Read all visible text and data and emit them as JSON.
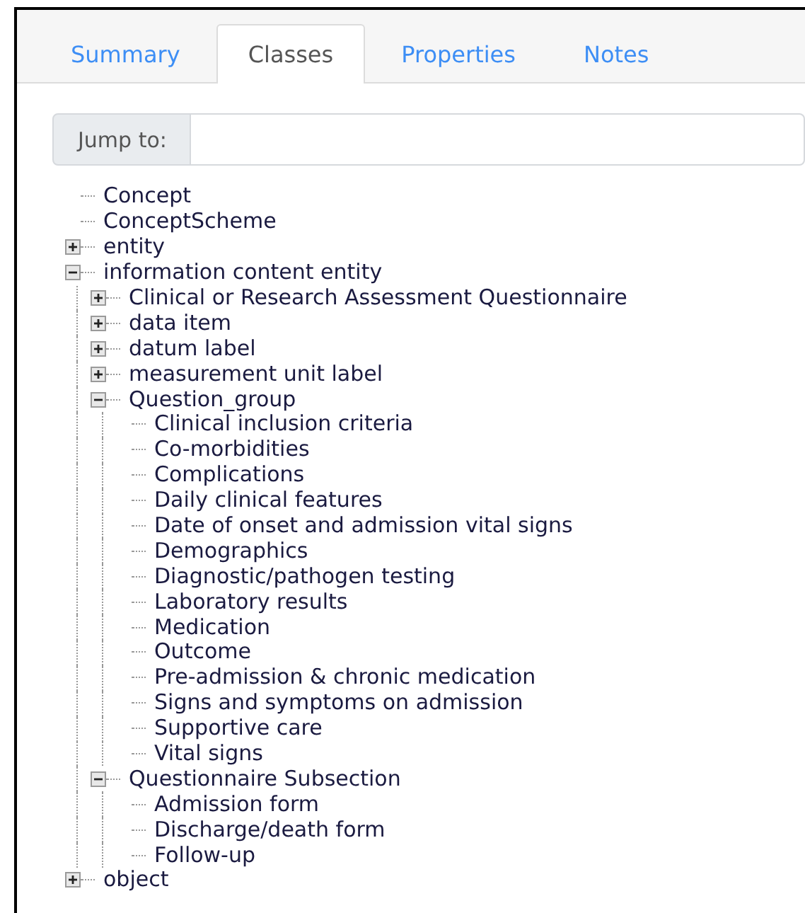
{
  "tabs": [
    {
      "label": "Summary",
      "selected": false
    },
    {
      "label": "Classes",
      "selected": true
    },
    {
      "label": "Properties",
      "selected": false
    },
    {
      "label": "Notes",
      "selected": false
    }
  ],
  "jump": {
    "label": "Jump to:"
  },
  "tree": [
    {
      "label": "Concept",
      "kind": "leaf"
    },
    {
      "label": "ConceptScheme",
      "kind": "leaf"
    },
    {
      "label": "entity",
      "kind": "branch",
      "expanded": false
    },
    {
      "label": "information content entity",
      "kind": "branch",
      "expanded": true,
      "children": [
        {
          "label": "Clinical or Research Assessment Questionnaire",
          "kind": "branch",
          "expanded": false
        },
        {
          "label": "data item",
          "kind": "branch",
          "expanded": false
        },
        {
          "label": "datum label",
          "kind": "branch",
          "expanded": false
        },
        {
          "label": "measurement unit label",
          "kind": "branch",
          "expanded": false
        },
        {
          "label": "Question_group",
          "kind": "branch",
          "expanded": true,
          "children": [
            {
              "label": "Clinical inclusion criteria",
              "kind": "leaf"
            },
            {
              "label": "Co-morbidities",
              "kind": "leaf"
            },
            {
              "label": "Complications",
              "kind": "leaf"
            },
            {
              "label": "Daily clinical features",
              "kind": "leaf"
            },
            {
              "label": "Date of onset and admission vital signs",
              "kind": "leaf"
            },
            {
              "label": "Demographics",
              "kind": "leaf"
            },
            {
              "label": "Diagnostic/pathogen testing",
              "kind": "leaf"
            },
            {
              "label": "Laboratory results",
              "kind": "leaf"
            },
            {
              "label": "Medication",
              "kind": "leaf"
            },
            {
              "label": "Outcome",
              "kind": "leaf"
            },
            {
              "label": "Pre-admission & chronic medication",
              "kind": "leaf"
            },
            {
              "label": "Signs and symptoms on admission",
              "kind": "leaf"
            },
            {
              "label": "Supportive care",
              "kind": "leaf"
            },
            {
              "label": "Vital signs",
              "kind": "leaf"
            }
          ]
        },
        {
          "label": "Questionnaire Subsection",
          "kind": "branch",
          "expanded": true,
          "children": [
            {
              "label": "Admission form",
              "kind": "leaf"
            },
            {
              "label": "Discharge/death form",
              "kind": "leaf"
            },
            {
              "label": "Follow-up",
              "kind": "leaf"
            }
          ]
        }
      ]
    },
    {
      "label": "object",
      "kind": "branch",
      "expanded": false
    }
  ]
}
